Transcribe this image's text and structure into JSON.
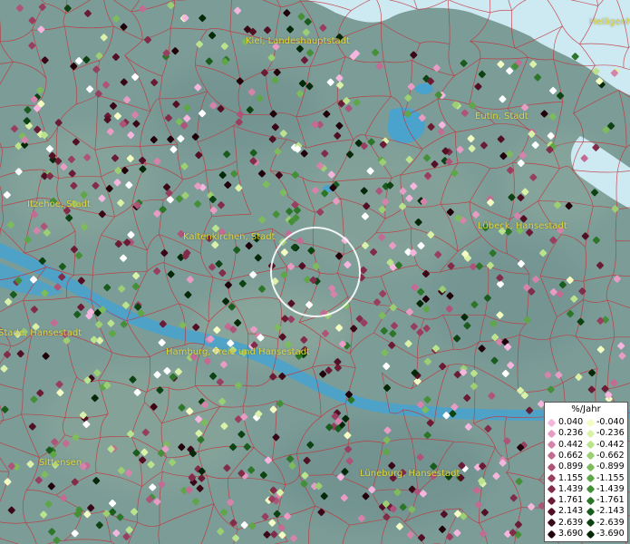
{
  "map": {
    "colors": {
      "land": "#7c9c97",
      "water": "#4aa3cc",
      "sea": "#cde9f2",
      "boundary": "#c4323a",
      "label": "#e0d63a",
      "circle": "#ffffff"
    },
    "cities": [
      {
        "id": "kiel",
        "label": "Kiel, Landeshauptstadt"
      },
      {
        "id": "heiligenhafen",
        "label": "Heiligenh"
      },
      {
        "id": "eutin",
        "label": "Eutin, Stadt"
      },
      {
        "id": "itzehoe",
        "label": "Itzehoe, Stadt"
      },
      {
        "id": "kaltenkirchen",
        "label": "Kaltenkirchen, Stadt"
      },
      {
        "id": "luebeck",
        "label": "Lübeck, Hansestadt"
      },
      {
        "id": "stade",
        "label": "Stade, Hansestadt"
      },
      {
        "id": "hamburg",
        "label": "Hamburg, Freie und Hansestadt"
      },
      {
        "id": "sittensen",
        "label": "Sittensen"
      },
      {
        "id": "lueneburg",
        "label": "Lüneburg, Hansestadt"
      }
    ]
  },
  "legend": {
    "title": "%/Jahr",
    "positive": [
      {
        "value": "0.040",
        "color": "#f5b6de"
      },
      {
        "value": "0.236",
        "color": "#e89cc4"
      },
      {
        "value": "0.442",
        "color": "#d583aa"
      },
      {
        "value": "0.662",
        "color": "#c36b92"
      },
      {
        "value": "0.899",
        "color": "#ae5478"
      },
      {
        "value": "1.155",
        "color": "#983f60"
      },
      {
        "value": "1.439",
        "color": "#812c49"
      },
      {
        "value": "1.761",
        "color": "#6a1c35"
      },
      {
        "value": "2.143",
        "color": "#521024"
      },
      {
        "value": "2.639",
        "color": "#3a0716"
      },
      {
        "value": "3.690",
        "color": "#22020a"
      }
    ],
    "negative": [
      {
        "value": "-0.040",
        "color": "#f3fcc2"
      },
      {
        "value": "-0.236",
        "color": "#d9f1a8"
      },
      {
        "value": "-0.442",
        "color": "#bbe28d"
      },
      {
        "value": "-0.662",
        "color": "#9ccf73"
      },
      {
        "value": "-0.899",
        "color": "#7dbb5c"
      },
      {
        "value": "-1.155",
        "color": "#5fa648"
      },
      {
        "value": "-1.439",
        "color": "#448f37"
      },
      {
        "value": "-1.761",
        "color": "#2d7629"
      },
      {
        "value": "-2.143",
        "color": "#1a5c1d"
      },
      {
        "value": "-2.639",
        "color": "#0d4212"
      },
      {
        "value": "-3.690",
        "color": "#042808"
      }
    ]
  }
}
